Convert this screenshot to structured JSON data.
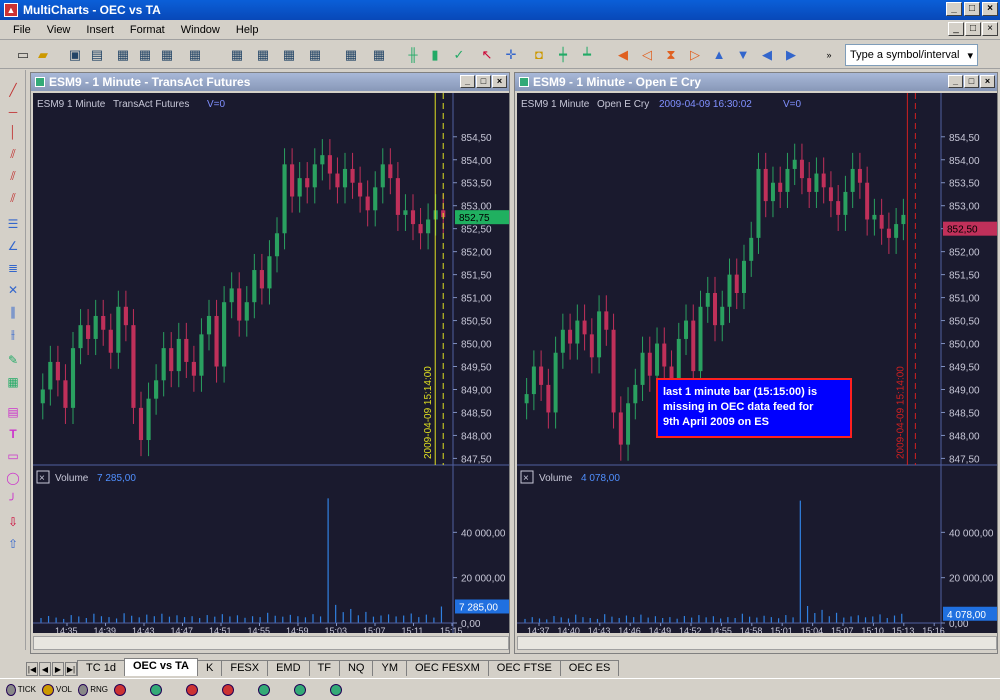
{
  "window": {
    "title": "MultiCharts - OEC vs TA",
    "min": "_",
    "max": "□",
    "close": "×"
  },
  "menu": [
    "File",
    "View",
    "Insert",
    "Format",
    "Window",
    "Help"
  ],
  "symbol_input": {
    "value": "Type a symbol/interval"
  },
  "left_chart": {
    "title": "ESM9 - 1 Minute - TransAct Futures",
    "header_symbol": "ESM9",
    "header_interval": "1 Minute",
    "header_source": "TransAct Futures",
    "header_vol": "V=0",
    "price_ticks": [
      "854,50",
      "854,00",
      "853,50",
      "853,00",
      "852,50",
      "852,00",
      "851,50",
      "851,00",
      "850,50",
      "850,00",
      "849,50",
      "849,00",
      "848,50",
      "848,00",
      "847,50"
    ],
    "last_price": "852,75",
    "vertical_label": "2009-04-09 15:14:00",
    "volume_label": "Volume",
    "volume_value": "7 285,00",
    "volume_ticks": [
      "40 000,00",
      "20 000,00",
      "0,00"
    ],
    "time_ticks": [
      "14:35",
      "14:39",
      "14:43",
      "14:47",
      "14:51",
      "14:55",
      "14:59",
      "15:03",
      "15:07",
      "15:11",
      "15:15"
    ]
  },
  "right_chart": {
    "title": "ESM9 - 1 Minute - Open E Cry",
    "header_symbol": "ESM9",
    "header_interval": "1 Minute",
    "header_source": "Open E Cry",
    "header_time": "2009-04-09  16:30:02",
    "header_vol": "V=0",
    "price_ticks": [
      "854,50",
      "854,00",
      "853,50",
      "853,00",
      "852,50",
      "852,00",
      "851,50",
      "851,00",
      "850,50",
      "850,00",
      "849,50",
      "849,00",
      "848,50",
      "848,00",
      "847,50"
    ],
    "last_price": "852,50",
    "vertical_label": "2009-04-09 15:14:00",
    "volume_label": "Volume",
    "volume_value": "4 078,00",
    "volume_ticks": [
      "40 000,00",
      "20 000,00",
      "0,00"
    ],
    "time_ticks": [
      "14:37",
      "14:40",
      "14:43",
      "14:46",
      "14:49",
      "14:52",
      "14:55",
      "14:58",
      "15:01",
      "15:04",
      "15:07",
      "15:10",
      "15:13",
      "15:16"
    ],
    "annotation": [
      "last 1 minute bar (15:15:00) is",
      "missing in OEC data feed for",
      "9th April 2009 on ES"
    ]
  },
  "tabs": [
    "TC 1d",
    "OEC vs TA",
    "K",
    "FESX",
    "EMD",
    "TF",
    "NQ",
    "YM",
    "OEC FESXM",
    "OEC FTSE",
    "OEC ES"
  ],
  "active_tab": "OEC vs TA",
  "status": [
    "TICK",
    "VOL",
    "RNG",
    "",
    "",
    "",
    "",
    "",
    "",
    "",
    "",
    ""
  ],
  "colors": {
    "bull": "#2aa060",
    "bear": "#c0305a",
    "bg": "#1a1a2e",
    "vol": "#3080e0",
    "left_marker": "#e0e020",
    "right_marker": "#d02020"
  },
  "chart_data": {
    "type": "candlestick",
    "series": [
      {
        "name": "TransAct Futures",
        "volume": [
          2200,
          3100,
          2400,
          1800,
          3500,
          2900,
          2200,
          4100,
          3000,
          2600,
          2000,
          4300,
          3200,
          2500,
          3700,
          3000,
          4100,
          2800,
          3400,
          2600,
          3000,
          2200,
          3500,
          2800,
          3900,
          2900,
          3400,
          2300,
          3000,
          2600,
          4500,
          3200,
          2800,
          3600,
          3000,
          2500,
          3900,
          2900,
          55000,
          8000,
          4800,
          6200,
          3400,
          4900,
          2800,
          3300,
          3800,
          2900,
          3300,
          4200,
          2600,
          3700,
          2400,
          7285
        ]
      },
      {
        "name": "Open E Cry",
        "volume": [
          1800,
          2600,
          2000,
          1600,
          3100,
          2500,
          2000,
          3700,
          2600,
          2200,
          1800,
          3900,
          2800,
          2200,
          3300,
          2600,
          3700,
          2400,
          3000,
          2200,
          2600,
          1900,
          3100,
          2400,
          3500,
          2500,
          3000,
          2000,
          2600,
          2200,
          4100,
          2800,
          2400,
          3200,
          2600,
          2100,
          3500,
          2500,
          54000,
          7500,
          4400,
          5800,
          3000,
          4500,
          2400,
          2900,
          3400,
          2500,
          2900,
          3800,
          2200,
          3300,
          4078
        ]
      }
    ]
  }
}
